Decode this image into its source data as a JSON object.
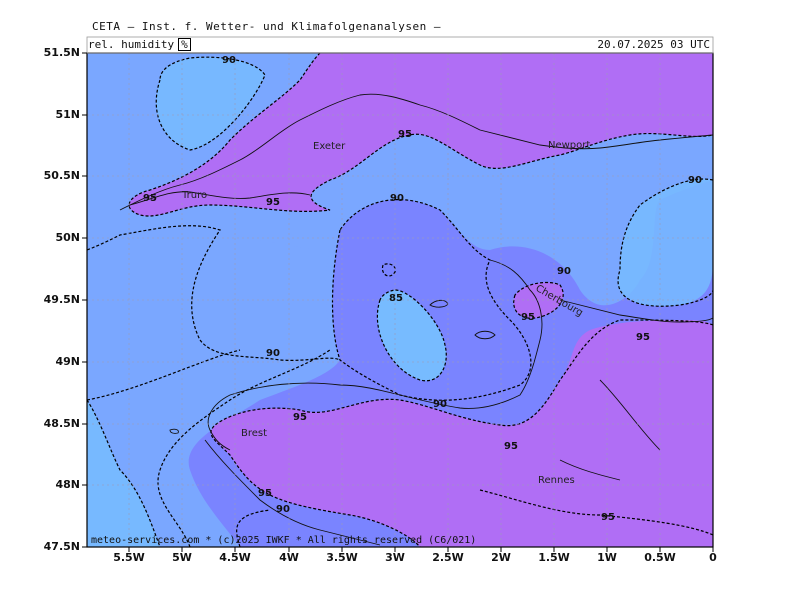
{
  "header": {
    "title": "CETA — Inst. f. Wetter- und Klimafolgenanalysen —",
    "parameter": "rel. humidity",
    "unit": "%",
    "datetime": "20.07.2025 03 UTC"
  },
  "axes": {
    "lat_labels": [
      "51.5N",
      "51N",
      "50.5N",
      "50N",
      "49.5N",
      "49N",
      "48.5N",
      "48N",
      "47.5N"
    ],
    "lon_labels": [
      "5.5W",
      "5W",
      "4.5W",
      "4W",
      "3.5W",
      "3W",
      "2.5W",
      "2W",
      "1.5W",
      "1W",
      "0.5W",
      "0"
    ]
  },
  "places": [
    "Exeter",
    "Truro",
    "Newport",
    "Cherbourg",
    "Brest",
    "Rennes"
  ],
  "contour_labels": [
    "90",
    "95",
    "95",
    "95",
    "90",
    "90",
    "90",
    "85",
    "95",
    "95",
    "90",
    "90",
    "95",
    "95",
    "90",
    "95",
    "95"
  ],
  "colors": {
    "rh_85": "#77bbff",
    "rh_90": "#7aa7ff",
    "rh_95": "#7a84ff",
    "rh_100": "#b06ef5"
  },
  "footer": "meteo-services.com * (c)2025 IWKF * All rights reserved (C6/021)"
}
